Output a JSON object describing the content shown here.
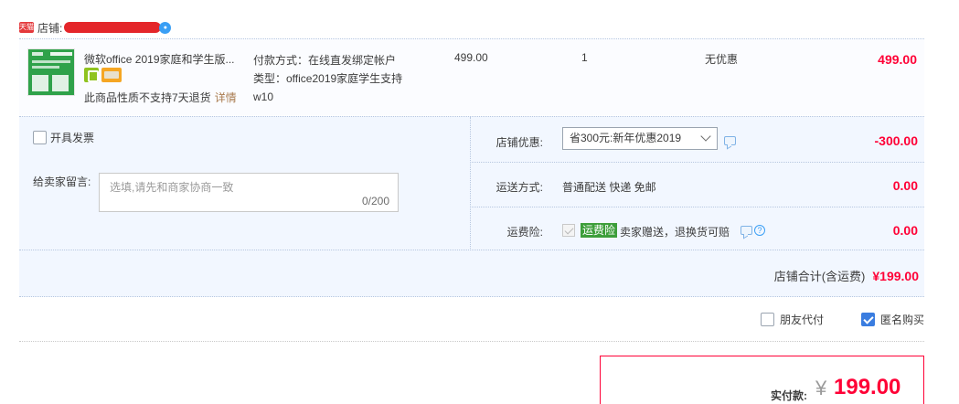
{
  "shop": {
    "icon": "tmall-icon",
    "icon_text": "天猫",
    "label": "店铺:",
    "chat_icon": "wangwang-icon"
  },
  "item": {
    "title": "微软office 2019家庭和学生版...",
    "return_note": "此商品性质不支持7天退货",
    "detail_link": "详情",
    "sku_lines": [
      "付款方式：在线直发绑定帐户",
      "类型：office2019家庭学生支持",
      "w10"
    ],
    "unit_price": "499.00",
    "quantity": "1",
    "discount": "无优惠",
    "subtotal": "499.00"
  },
  "invoice": {
    "label": "开具发票",
    "checked": false
  },
  "message": {
    "label": "给卖家留言:",
    "placeholder": "选填,请先和商家协商一致",
    "count": "0/200"
  },
  "coupon": {
    "label": "店铺优惠:",
    "selected": "省300元:新年优惠2019",
    "amount": "-300.00"
  },
  "shipping": {
    "label": "运送方式:",
    "value": "普通配送 快递 免邮",
    "amount": "0.00"
  },
  "insurance": {
    "label": "运费险:",
    "tag": "运费险",
    "desc": "卖家赠送，退换货可赔",
    "amount": "0.00",
    "tag_color": "#3d9e3a"
  },
  "shop_total": {
    "label": "店铺合计(含运费)",
    "amount": "¥199.00"
  },
  "buy_options": [
    {
      "label": "朋友代付",
      "checked": false
    },
    {
      "label": "匿名购买",
      "checked": true
    }
  ],
  "payment": {
    "label": "实付款:",
    "currency": "¥",
    "amount": "199.00"
  },
  "colors": {
    "price_red": "#ff0036",
    "panel_bg": "#f2f7ff",
    "link_brown": "#a97b4f"
  }
}
